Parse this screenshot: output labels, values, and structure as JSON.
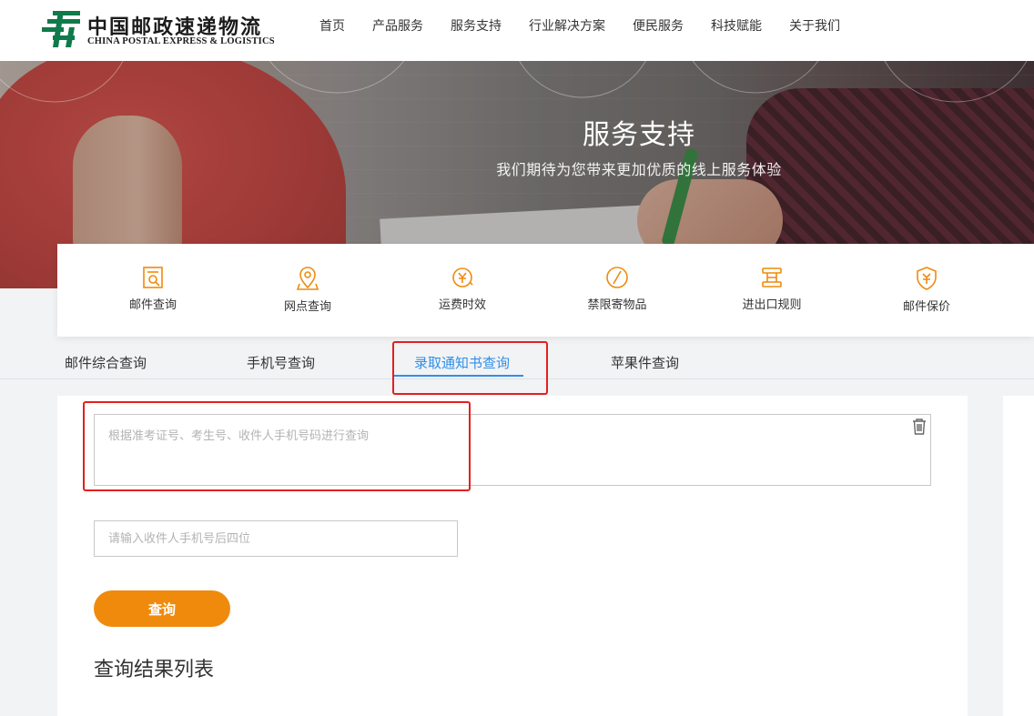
{
  "header": {
    "logo_cn": "中国邮政速递物流",
    "logo_en": "CHINA POSTAL EXPRESS & LOGISTICS",
    "nav": [
      "首页",
      "产品服务",
      "服务支持",
      "行业解决方案",
      "便民服务",
      "科技赋能",
      "关于我们"
    ]
  },
  "banner": {
    "title": "服务支持",
    "subtitle": "我们期待为您带来更加优质的线上服务体验"
  },
  "services": [
    {
      "label": "邮件查询",
      "icon": "mail-search-icon"
    },
    {
      "label": "网点查询",
      "icon": "location-pin-icon"
    },
    {
      "label": "运费时效",
      "icon": "yuan-clock-icon"
    },
    {
      "label": "禁限寄物品",
      "icon": "prohibited-icon"
    },
    {
      "label": "进出口规则",
      "icon": "rules-icon"
    },
    {
      "label": "邮件保价",
      "icon": "yuan-shield-icon"
    }
  ],
  "tabs": [
    "邮件综合查询",
    "手机号查询",
    "录取通知书查询",
    "苹果件查询"
  ],
  "active_tab": "录取通知书查询",
  "form": {
    "query_placeholder": "根据准考证号、考生号、收件人手机号码进行查询",
    "query_value": "",
    "phone_placeholder": "请输入收件人手机号后四位",
    "phone_value": "",
    "query_button": "查询"
  },
  "result_title": "查询结果列表",
  "colors": {
    "brand_green": "#0f7a4a",
    "accent_orange": "#f08a0c",
    "tab_active": "#2f8fe8",
    "highlight_red": "#e3201d"
  }
}
